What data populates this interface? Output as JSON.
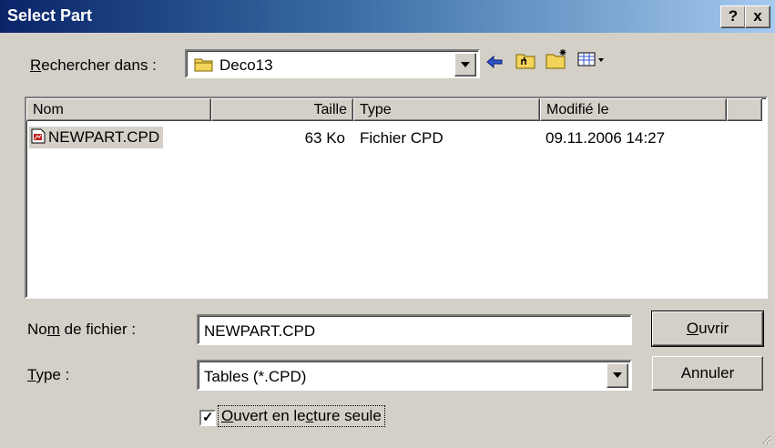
{
  "title": "Select Part",
  "title_buttons": {
    "help": "?",
    "close": "x"
  },
  "look_in": {
    "label_u": "R",
    "label_rest": "echercher dans :",
    "value": "Deco13"
  },
  "list": {
    "columns": [
      "Nom",
      "Taille",
      "Type",
      "Modifié le"
    ],
    "rows": [
      {
        "name": "NEWPART.CPD",
        "size": "63 Ko",
        "type": "Fichier CPD",
        "modified": "09.11.2006 14:27"
      }
    ]
  },
  "filename": {
    "label_a": "No",
    "label_u": "m",
    "label_b": " de fichier :",
    "value": "NEWPART.CPD"
  },
  "filetype": {
    "label_u": "T",
    "label_rest": "ype :",
    "value": "Tables (*.CPD)"
  },
  "buttons": {
    "open_u": "O",
    "open_rest": "uvrir",
    "cancel": "Annuler"
  },
  "readonly": {
    "checked": true,
    "label_u": "O",
    "label_a": "uvert en le",
    "label_u2": "c",
    "label_b": "ture seule"
  },
  "icons": [
    "folder-icon",
    "back-icon",
    "up-folder-icon",
    "new-folder-icon",
    "view-menu-icon",
    "file-icon",
    "resize-grip-icon"
  ]
}
